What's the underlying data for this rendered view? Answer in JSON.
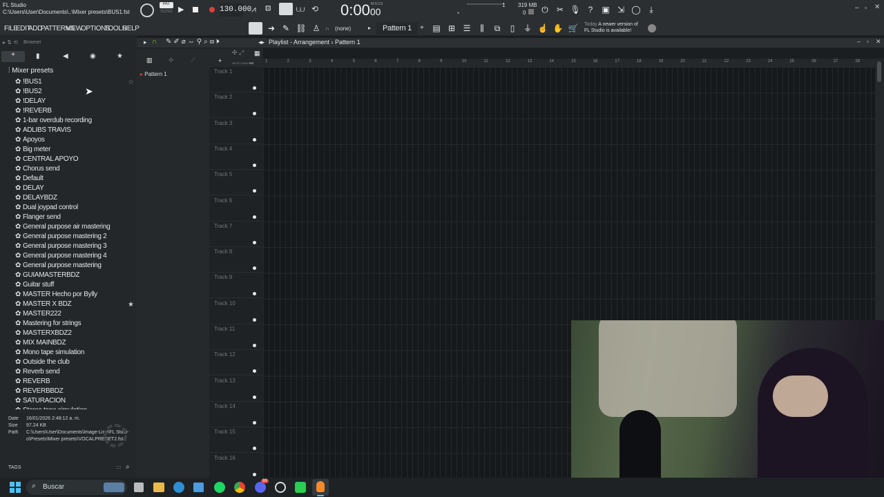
{
  "app": {
    "name": "FL Studio",
    "file_path": "C:\\Users\\User\\Documents\\..\\Mixer presets\\BUS1.fst"
  },
  "transport": {
    "pat_label": "PAT",
    "song_label": "SONG",
    "tempo": "130.000",
    "time": "0:00",
    "time_small": "00",
    "time_unit": "M:S:CS",
    "memory": "319 MB",
    "cpu_num": "1",
    "cpu_zero": "0"
  },
  "menu": [
    "FILE",
    "EDIT",
    "ADD",
    "PATTERNS",
    "VIEW",
    "OPTIONS",
    "TOOLS",
    "HELP"
  ],
  "toolbar": {
    "none_label": "(none)",
    "pattern_label": "Pattern 1",
    "news_today": "Today",
    "news_text_1": "A newer version of",
    "news_text_2": "FL Studio is available!"
  },
  "browser": {
    "title": "Browser",
    "folder": "Mixer presets",
    "items": [
      "!BUS1",
      "!BUS2",
      "!DELAY",
      "!REVERB",
      "1-bar overdub recording",
      "ADLIBS TRAVIS",
      "Apoyos",
      "Big meter",
      "CENTRAL APOYO",
      "Chorus send",
      "Default",
      "DELAY",
      "DELAYBDZ",
      "Dual joypad control",
      "Flanger send",
      "General purpose air mastering",
      "General purpose mastering 2",
      "General purpose mastering 3",
      "General purpose mastering 4",
      "General purpose mastering",
      "GUIAMASTERBDZ",
      "Guitar stuff",
      "MASTER Hecho por Bylly",
      "MASTER X BDZ",
      "MASTER222",
      "Mastering for strings",
      "MASTERXBDZ2",
      "MIX MAINBDZ",
      "Mono tape simulation",
      "Outside the club",
      "Reverb send",
      "REVERB",
      "REVERBBDZ",
      "SATURACION",
      "Stereo tape simulation"
    ],
    "info": {
      "date_label": "Date",
      "date_value": "16/01/2026 2:48:12 a. m.",
      "size_label": "Size",
      "size_value": "97.24 KB",
      "path_label": "Path",
      "path_value_1": "C:\\Users\\User\\Documents\\Image-Line\\FL Studi-",
      "path_value_2": "o\\Presets\\Mixer presets\\VOCALPRESET2.fst"
    },
    "tags_label": "TAGS"
  },
  "playlist": {
    "title": "Playlist - Arrangement",
    "pattern": "Pattern 1",
    "picker_item": "Pattern 1",
    "tracks": [
      "Track 1",
      "Track 2",
      "Track 3",
      "Track 4",
      "Track 5",
      "Track 6",
      "Track 7",
      "Track 8",
      "Track 9",
      "Track 10",
      "Track 11",
      "Track 12",
      "Track 13",
      "Track 14",
      "Track 15",
      "Track 16"
    ],
    "ruler": [
      "1",
      "2",
      "3",
      "4",
      "5",
      "6",
      "7",
      "8",
      "9",
      "10",
      "11",
      "12",
      "13",
      "14",
      "15",
      "16",
      "17",
      "18",
      "19",
      "20",
      "21",
      "22",
      "23",
      "24",
      "25",
      "26",
      "27",
      "28"
    ],
    "ruler_side": [
      "NOTE",
      "CHAN",
      "PAT"
    ]
  },
  "taskbar": {
    "search_placeholder": "Buscar",
    "discord_badge": "99"
  },
  "colors": {
    "accent_orange": "#f28a2e",
    "accent_green": "#8bd13a",
    "record_red": "#e0403a"
  }
}
